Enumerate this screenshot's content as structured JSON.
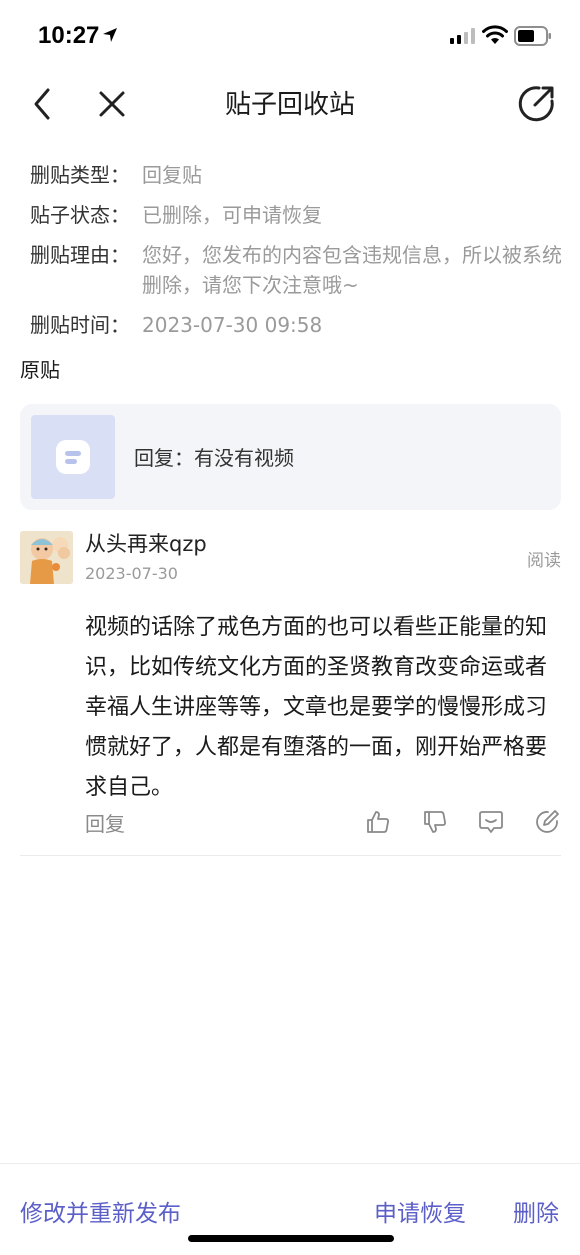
{
  "status_bar": {
    "time": "10:27"
  },
  "nav": {
    "title": "贴子回收站"
  },
  "info": {
    "type_label": "删贴类型：",
    "type_value": "回复贴",
    "state_label": "贴子状态：",
    "state_value": "已删除，可申请恢复",
    "reason_label": "删贴理由：",
    "reason_value": "您好，您发布的内容包含违规信息，所以被系统删除，请您下次注意哦~",
    "time_label": "删贴时间：",
    "time_value": "2023-07-30 09:58"
  },
  "original": {
    "label": "原贴",
    "text": "回复：有没有视频"
  },
  "reply": {
    "author": "从头再来qzp",
    "date": "2023-07-30",
    "read_tag": "阅读",
    "content": " 视频的话除了戒色方面的也可以看些正能量的知识，比如传统文化方面的圣贤教育改变命运或者幸福人生讲座等等，文章也是要学的慢慢形成习惯就好了，人都是有堕落的一面，刚开始严格要求自己。",
    "reply_label": "回复"
  },
  "bottom": {
    "edit_label": "修改并重新发布",
    "restore_label": "申请恢复",
    "delete_label": "删除"
  },
  "colors": {
    "accent": "#5b5fc7",
    "muted": "#9a9a9a"
  },
  "icons": {
    "back": "chevron-left-icon",
    "close": "close-icon",
    "share": "share-icon",
    "like": "thumb-up-icon",
    "dislike": "thumb-down-icon",
    "comment": "comment-icon",
    "edit": "edit-icon"
  }
}
